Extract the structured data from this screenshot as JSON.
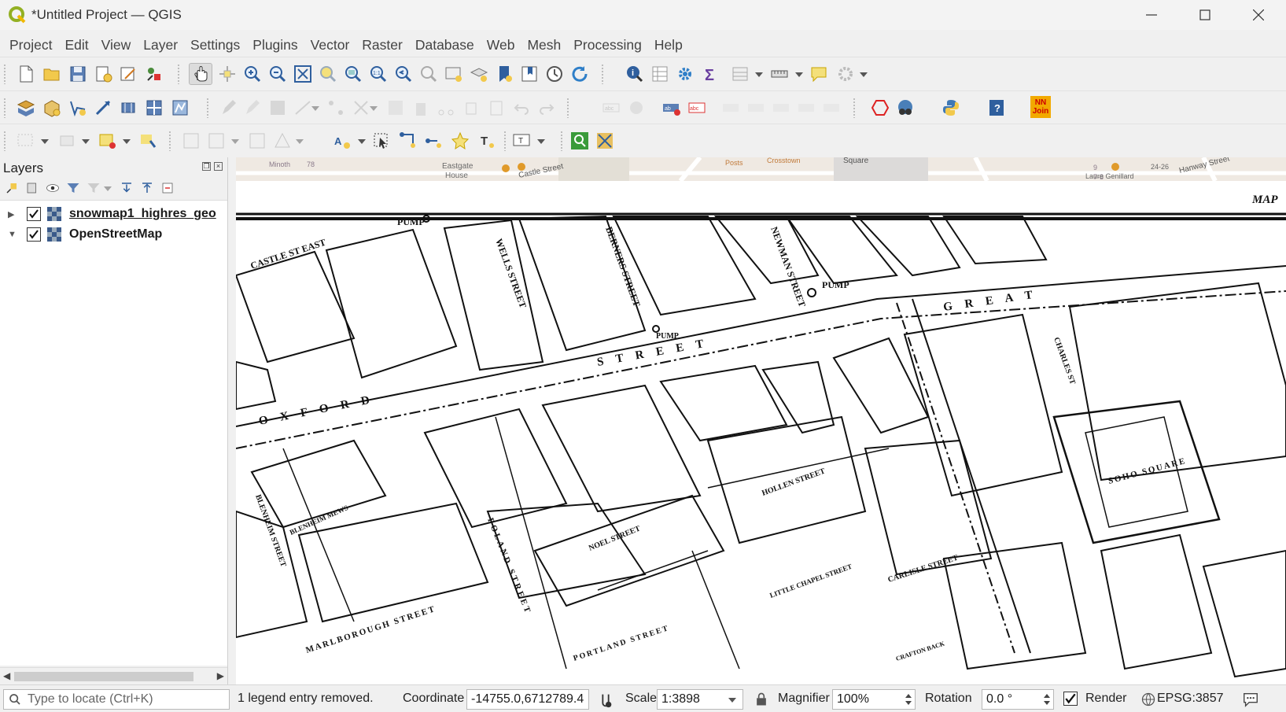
{
  "window": {
    "title": "*Untitled Project — QGIS"
  },
  "menu": [
    "Project",
    "Edit",
    "View",
    "Layer",
    "Settings",
    "Plugins",
    "Vector",
    "Raster",
    "Database",
    "Web",
    "Mesh",
    "Processing",
    "Help"
  ],
  "toolbar_icons": {
    "row1": [
      "new-project-icon",
      "open-project-icon",
      "save-project-icon",
      "new-print-layout-icon",
      "show-layout-manager-icon",
      "style-manager-icon",
      "pan-map-icon",
      "pan-to-selection-icon",
      "zoom-in-icon",
      "zoom-out-icon",
      "zoom-full-icon",
      "zoom-to-selection-icon",
      "zoom-to-layer-icon",
      "zoom-native-icon",
      "zoom-last-icon",
      "zoom-next-icon",
      "new-map-view-icon",
      "new-3d-map-view-icon",
      "new-spatial-bookmark-icon",
      "show-bookmarks-icon",
      "temporal-controller-icon",
      "refresh-icon",
      "identify-icon",
      "open-attribute-table-icon",
      "toolbox-icon",
      "statistical-summary-icon",
      "attribute-table-dropdown-icon",
      "measure-line-icon",
      "map-tips-icon",
      "annotation-icon"
    ],
    "row2": [
      "data-source-manager-icon",
      "new-geopackage-layer-icon",
      "new-shapefile-layer-icon",
      "new-spatialite-layer-icon",
      "new-temporary-layer-icon",
      "new-virtual-layer-icon",
      "create-layer-icon"
    ],
    "row3": [
      "select-features-icon",
      "deselect-features-icon",
      "select-by-expression-icon",
      "label-tool-icon",
      "node-tool-icon",
      "georeferencer-icon"
    ]
  },
  "plugin_badge": {
    "line1": "NN",
    "line2": "Join"
  },
  "layers_panel": {
    "title": "Layers",
    "layers": [
      {
        "name": "snowmap1_highres_geo",
        "checked": true,
        "expanded": false
      },
      {
        "name": "OpenStreetMap",
        "checked": true,
        "expanded": true
      }
    ]
  },
  "map": {
    "osm_labels": [
      "Minoth",
      "78",
      "Eastgate",
      "House",
      "Castle Street",
      "Posts",
      "Crosstown",
      "Square",
      "9",
      "7-8",
      "Laure Genillard",
      "24-26",
      "Hanway Street"
    ],
    "snow_labels": [
      "MAP",
      "PUMP",
      "CASTLE ST EAST",
      "WELLS STREET",
      "BERNERS STREET",
      "NEWMAN STREET",
      "PUMP",
      "PUMP",
      "G R E A T",
      "O X F O R D",
      "S T R E E T",
      "CHARLES ST",
      "SOHO SQUARE",
      "HOLLEN STREET",
      "NOEL STREET",
      "BLENHEIM MEWS",
      "BLENHEIM STREET",
      "MARLBOROUGH STREET",
      "POLAND STREET",
      "PORTLAND STREET",
      "LITTLE CHAPEL STREET",
      "CARLISLE STREET",
      "CRAFTON BACK"
    ]
  },
  "status": {
    "locator_placeholder": "Type to locate (Ctrl+K)",
    "message": "1 legend entry removed.",
    "coordinate_label": "Coordinate",
    "coordinate_value": "-14755.0,6712789.4",
    "scale_label": "Scale",
    "scale_value": "1:3898",
    "magnifier_label": "Magnifier",
    "magnifier_value": "100%",
    "rotation_label": "Rotation",
    "rotation_value": "0.0 °",
    "render_label": "Render",
    "render_checked": true,
    "crs": "EPSG:3857"
  }
}
